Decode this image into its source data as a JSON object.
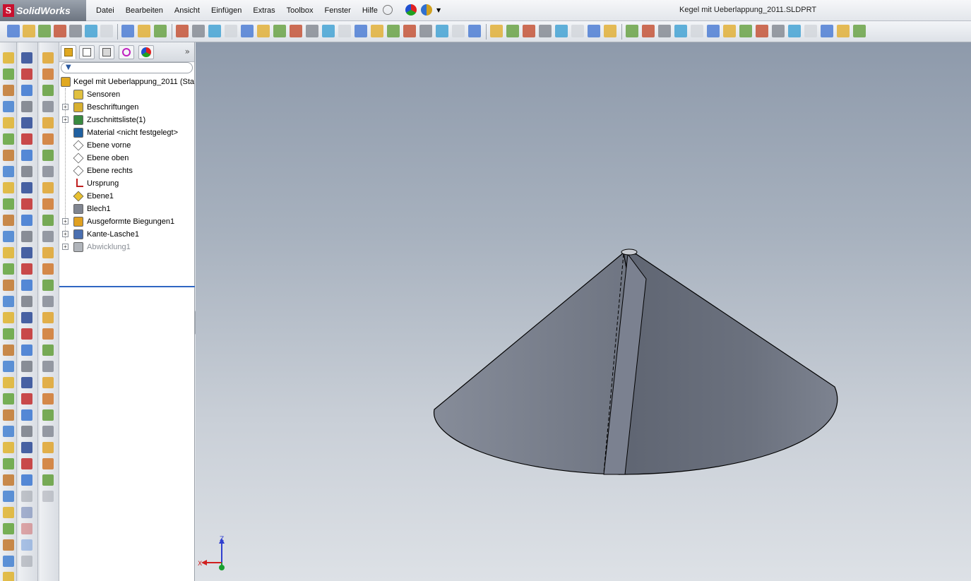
{
  "app": {
    "name": "SolidWorks",
    "logo_letter": "S"
  },
  "menu": [
    "Datei",
    "Bearbeiten",
    "Ansicht",
    "Einfügen",
    "Extras",
    "Toolbox",
    "Fenster",
    "Hilfe"
  ],
  "window": {
    "title": "Kegel mit Ueberlappung_2011.SLDPRT"
  },
  "panel": {
    "tabs": [
      "feature-manager",
      "property-manager",
      "configuration-manager",
      "dimxpert-manager",
      "display-manager"
    ],
    "expand_label": "»",
    "filter_placeholder": ""
  },
  "tree": [
    {
      "label": "Kegel mit Ueberlappung_2011  (Sta",
      "icon": "part-icon",
      "expandable": false,
      "root": true
    },
    {
      "label": "Sensoren",
      "icon": "sensor-icon",
      "expandable": false
    },
    {
      "label": "Beschriftungen",
      "icon": "annotation-icon",
      "expandable": true
    },
    {
      "label": "Zuschnittsliste(1)",
      "icon": "cut-list-icon",
      "expandable": true
    },
    {
      "label": "Material <nicht festgelegt>",
      "icon": "material-icon",
      "expandable": false
    },
    {
      "label": "Ebene vorne",
      "icon": "plane-icon",
      "expandable": false
    },
    {
      "label": "Ebene oben",
      "icon": "plane-icon",
      "expandable": false
    },
    {
      "label": "Ebene rechts",
      "icon": "plane-icon",
      "expandable": false
    },
    {
      "label": "Ursprung",
      "icon": "origin-icon",
      "expandable": false
    },
    {
      "label": "Ebene1",
      "icon": "plane-yellow-icon",
      "expandable": false
    },
    {
      "label": "Blech1",
      "icon": "sheet-metal-icon",
      "expandable": false
    },
    {
      "label": "Ausgeformte Biegungen1",
      "icon": "lofted-bend-icon",
      "expandable": true
    },
    {
      "label": "Kante-Lasche1",
      "icon": "edge-flange-icon",
      "expandable": true
    },
    {
      "label": "Abwicklung1",
      "icon": "flat-pattern-icon",
      "expandable": true,
      "suppressed": true
    }
  ],
  "triad": {
    "x_label": "X",
    "z_label": "Z"
  },
  "colors": {
    "accent": "#2f67c2",
    "model_fill": "#747a87",
    "viewport_top": "#8e9aab",
    "viewport_bottom": "#dde1e6"
  }
}
